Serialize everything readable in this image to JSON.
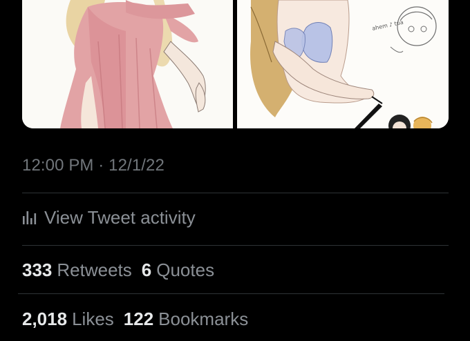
{
  "tweet": {
    "timestamp": "12:00 PM · 12/1/22",
    "activity_label": "View Tweet activity",
    "stats_primary": [
      {
        "count": "333",
        "label": "Retweets"
      },
      {
        "count": "6",
        "label": "Quotes"
      }
    ],
    "stats_secondary": [
      {
        "count": "2,018",
        "label": "Likes"
      },
      {
        "count": "122",
        "label": "Bookmarks"
      }
    ]
  },
  "media": {
    "handwritten_note": "ahem ♪ tua"
  },
  "colors": {
    "background": "#000000",
    "primary_text": "#e7e9ea",
    "secondary_text": "#71767b",
    "divider": "#2f3336"
  }
}
